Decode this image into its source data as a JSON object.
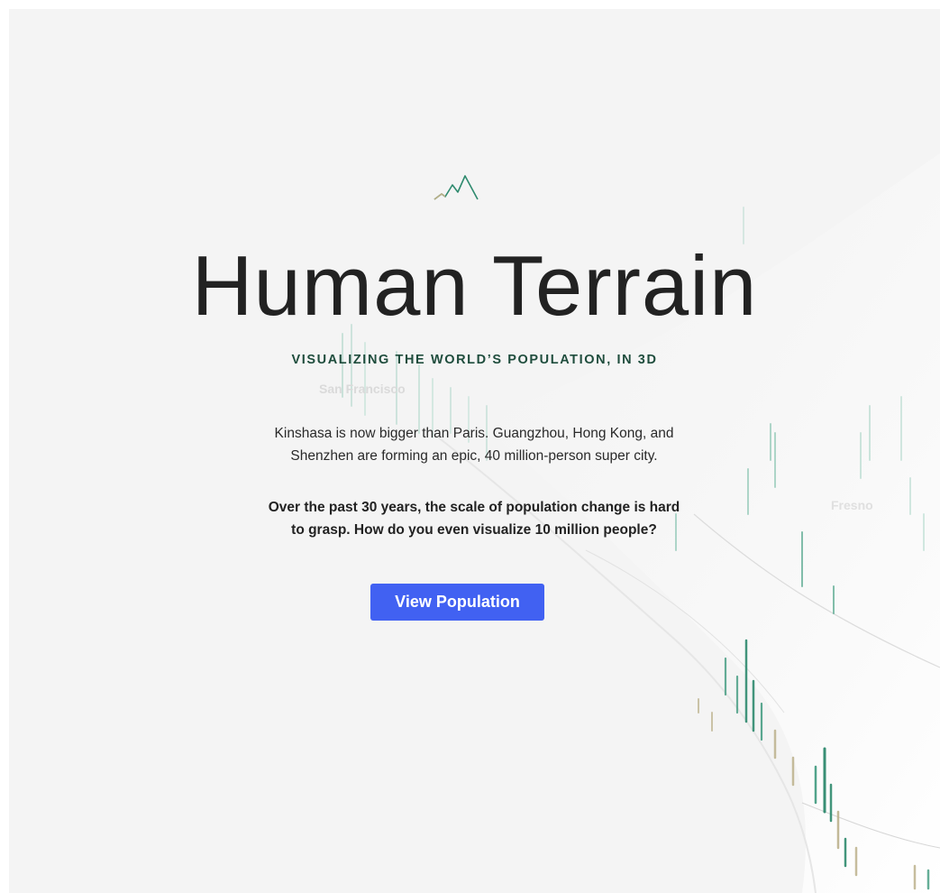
{
  "hero": {
    "title": "Human Terrain",
    "subtitle": "VISUALIZING THE WORLD’S POPULATION, IN 3D",
    "intro_line1": "Kinshasa is now bigger than Paris. Guangzhou, Hong Kong, and",
    "intro_line2": "Shenzhen are forming an epic, 40 million-person super city.",
    "question_line1": "Over the past 30 years, the scale of population change is hard",
    "question_line2": "to grasp. How do you even visualize 10 million people?",
    "cta_label": "View Population",
    "logo_icon": "mountain-peaks-icon"
  },
  "map": {
    "cities": [
      "San Francisco",
      "Fresno"
    ]
  },
  "colors": {
    "background": "#f4f4f4",
    "accent_button": "#4161f2",
    "subtitle_green": "#1f4d3d",
    "spike_teal": "#2e8a6e",
    "spike_tan": "#b9ae86"
  }
}
